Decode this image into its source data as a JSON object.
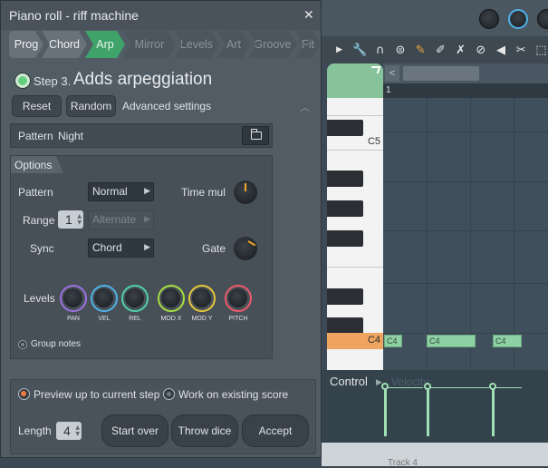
{
  "dialog": {
    "title": "Piano roll - riff machine",
    "close_glyph": "✕",
    "tabs": [
      {
        "label": "Prog",
        "state": "done"
      },
      {
        "label": "Chord",
        "state": "done"
      },
      {
        "label": "Arp",
        "state": "active"
      },
      {
        "label": "Mirror",
        "state": "todo"
      },
      {
        "label": "Levels",
        "state": "todo"
      },
      {
        "label": "Art",
        "state": "todo"
      },
      {
        "label": "Groove",
        "state": "todo"
      },
      {
        "label": "Fit",
        "state": "todo"
      }
    ],
    "step": {
      "number": "Step 3.",
      "title": "Adds arpeggiation"
    },
    "actions": {
      "reset": "Reset",
      "random": "Random",
      "advanced": "Advanced settings"
    },
    "pattern": {
      "label": "Pattern",
      "value": "Night"
    },
    "options": {
      "header": "Options",
      "pattern_label": "Pattern",
      "pattern_value": "Normal",
      "time_mul_label": "Time mul",
      "range_label": "Range",
      "range_value": "1",
      "range_mode": "Alternate",
      "sync_label": "Sync",
      "sync_value": "Chord",
      "gate_label": "Gate",
      "levels_label": "Levels",
      "levels": [
        {
          "label": "PAN",
          "color": "#a070e0"
        },
        {
          "label": "VEL",
          "color": "#4fb3e8"
        },
        {
          "label": "REL",
          "color": "#4fd2a8"
        },
        {
          "label": "MOD X",
          "color": "#a6e040"
        },
        {
          "label": "MOD Y",
          "color": "#e8c83a"
        },
        {
          "label": "PITCH",
          "color": "#f05a6a"
        }
      ],
      "group_notes": "Group notes"
    },
    "bottom": {
      "preview": "Preview up to current step",
      "work_existing": "Work on existing score",
      "length_label": "Length",
      "length_value": "4",
      "start_over": "Start over",
      "throw_dice": "Throw dice",
      "accept": "Accept"
    }
  },
  "piano_roll": {
    "bar_number": "1",
    "key_c5": "C5",
    "key_c4": "C4",
    "notes": [
      "C4",
      "C4",
      "C4"
    ],
    "control_label": "Control",
    "velocity_label": "Velocity",
    "track_label": "Track 4",
    "nav_left": "<",
    "accent": "#86c39a"
  }
}
